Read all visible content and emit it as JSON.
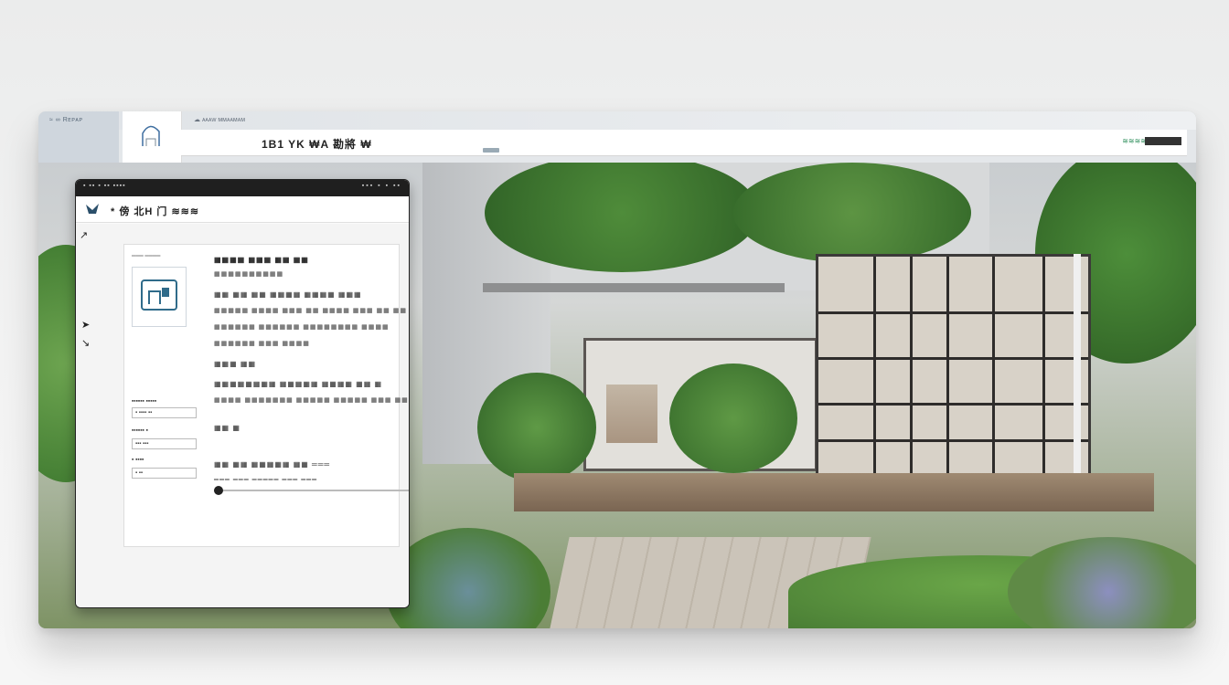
{
  "browser": {
    "brand": "≈ ∞ Rᴇᴘᴀᴘ",
    "tab_text": "☁ ᴀᴀᴀᴡ ᴍᴍᴀᴀᴍᴀᴍ",
    "title": "1B1 YK ₩A 勘將 ₩",
    "right_status": "≋≋≋≋"
  },
  "dialog": {
    "titlebar_left": "▪ ▪▪ ▪  ▪▪ ▪▪▪▪",
    "titlebar_right": "▪▪▪ ▪ ▪ ▪▪",
    "heading": "* 傍 北H 门 ≋≋≋",
    "preview_label": "═══ ════",
    "lines": [
      "▦▦▦▦ ▦▦▦ ▦▦ ▦▦",
      "▦▦▦▦▦▦▦▦▦▦",
      "▦▦ ▦▦ ▦▦ ▦▦▦▦ ▦▦▦▦ ▦▦▦",
      "▦▦▦▦▦ ▦▦▦▦ ▦▦▦ ▦▦ ▦▦▦▦ ▦▦▦ ▦▦ ▦▦",
      "▦▦▦▦▦▦ ▦▦▦▦▦▦ ▦▦▦▦▦▦▦▦ ▦▦▦▦",
      "▦▦▦▦▦▦ ▦▦▦ ▦▦▦▦",
      "▦▦▦ ▦▦",
      "▦▦▦▦▦▦▦▦ ▦▦▦▦▦ ▦▦▦▦ ▦▦ ▦",
      "▦▦▦▦ ▦▦▦▦▦▦▦ ▦▦▦▦▦ ▦▦▦▦▦ ▦▦▦ ▦▦▦▦",
      "▦▦ ▦",
      "▦▦ ▦▦ ▦▦▦▦▦ ▦▦ ═══",
      "═══ ═══ ═════ ═══ ═══"
    ],
    "fields": [
      {
        "label": "▪▪▪▪▪▪ ▪▪▪▪▪",
        "value": "▪ ▪▪▪▪ ▪▪"
      },
      {
        "label": "▪▪▪▪▪▪ ▪",
        "value": "▪▪▪ ▪▪▪"
      },
      {
        "label": "▪ ▪▪▪▪",
        "value": "▪ ▪▪"
      }
    ]
  },
  "colors": {
    "accent_green": "#2e8f5c",
    "titlebar": "#1f1f1f"
  }
}
